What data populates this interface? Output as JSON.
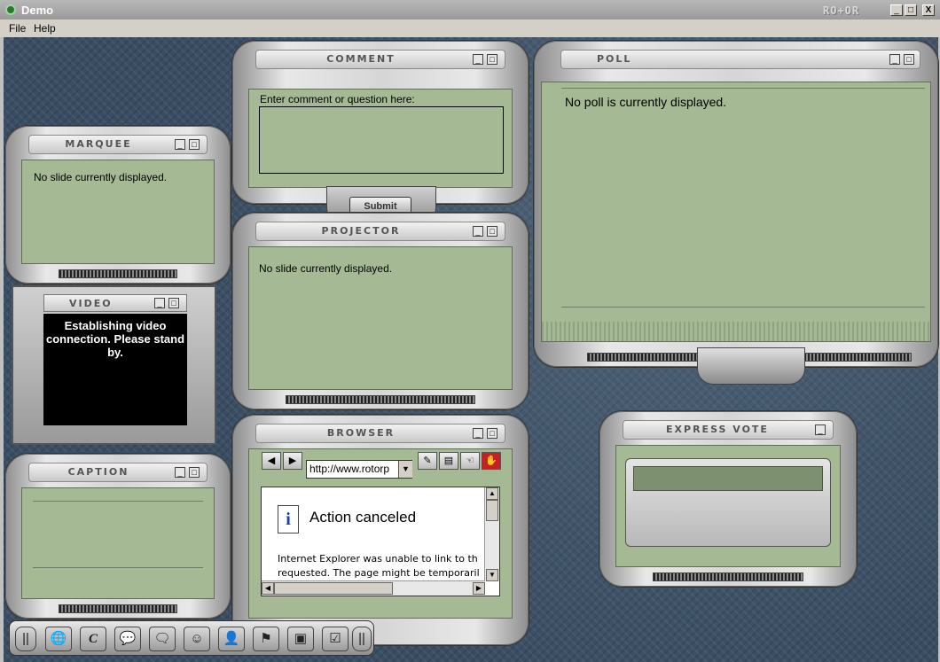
{
  "app": {
    "title": "Demo",
    "brand": "RO+OR"
  },
  "window_controls": {
    "minimize": "_",
    "maximize": "□",
    "close": "X"
  },
  "menu": {
    "items": [
      "File",
      "Help"
    ]
  },
  "panels": {
    "comment": {
      "title": "COMMENT",
      "label": "Enter comment or question here:",
      "submit_label": "Submit"
    },
    "poll": {
      "title": "POLL",
      "message": "No poll is currently displayed."
    },
    "marquee": {
      "title": "MARQUEE",
      "message": "No slide currently displayed."
    },
    "projector": {
      "title": "PROJECTOR",
      "message": "No slide currently displayed."
    },
    "video": {
      "title": "VIDEO",
      "message": "Establishing video connection. Please stand by."
    },
    "caption": {
      "title": "CAPTION"
    },
    "browser": {
      "title": "BROWSER",
      "url": "http://www.rotorp",
      "page_heading": "Action canceled",
      "page_text_1": "Internet Explorer was unable to link to th",
      "page_text_2": "requested. The page might be temporaril"
    },
    "express_vote": {
      "title": "EXPRESS VOTE"
    }
  },
  "colors": {
    "panel_body": "#a5b995",
    "desktop": "#3a4e63"
  },
  "toolbar_icons": [
    "grip-icon",
    "globe-icon",
    "c-icon",
    "chat-icon",
    "comment-icon",
    "masks-icon",
    "person-icon",
    "flag-icon",
    "screen-icon",
    "checklist-icon",
    "grip-icon"
  ]
}
